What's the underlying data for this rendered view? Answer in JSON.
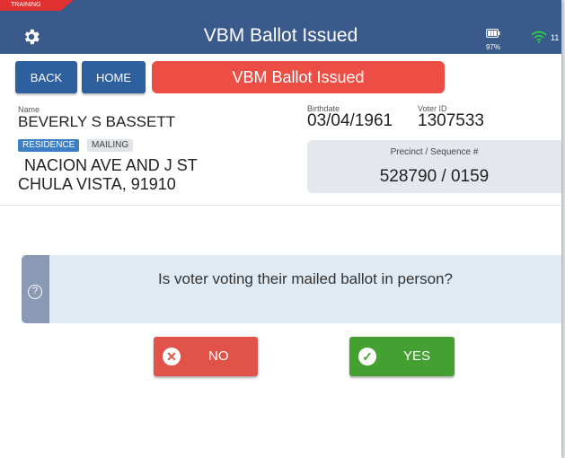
{
  "header": {
    "training_label": "TRAINING",
    "title": "VBM Ballot Issued",
    "battery_pct": "97%",
    "wifi_text": "11",
    "colors": {
      "bar": "#3a5a8c",
      "ribbon": "#e03030"
    }
  },
  "nav": {
    "back_label": "BACK",
    "home_label": "HOME",
    "status_banner": "VBM Ballot Issued"
  },
  "voter": {
    "name_label": "Name",
    "name": "BEVERLY S BASSETT",
    "birthdate_label": "Birthdate",
    "birthdate": "03/04/1961",
    "voter_id_label": "Voter ID",
    "voter_id": "1307533",
    "tags": {
      "residence": "RESIDENCE",
      "mailing": "MAILING"
    },
    "address_line1": "NACION AVE AND J ST",
    "address_line2": "CHULA VISTA, 91910",
    "precinct_label": "Precinct / Sequence #",
    "precinct_value": "528790 / 0159"
  },
  "question": {
    "icon": "help-circle-icon",
    "text": "Is voter voting their mailed ballot in person?"
  },
  "answers": {
    "no_label": "NO",
    "yes_label": "YES",
    "colors": {
      "no": "#e15249",
      "yes": "#45a032"
    }
  }
}
